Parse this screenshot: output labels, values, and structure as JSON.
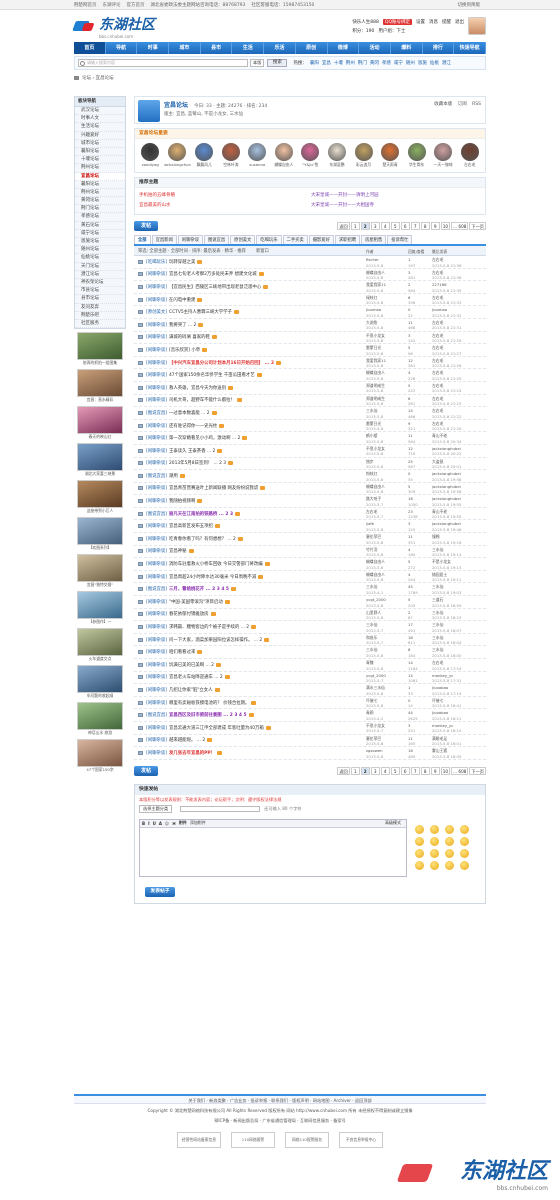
{
  "topbar": {
    "left": [
      "荆楚网首页",
      "东湖评论",
      "官方首页",
      "湖北省委政法委主题网站咨询电话：88768793",
      "社区客服电话：15987453150"
    ],
    "right": "切换到简版"
  },
  "header": {
    "logo": "东湖社区",
    "logo_sub": "bbs.cnhubei.com",
    "user": "快乐人生888",
    "msg": "QQ账号绑定",
    "links": [
      "设置",
      "消息",
      "提醒",
      "退出"
    ],
    "score": "积分：190",
    "group": "用户组：下士"
  },
  "nav": [
    "首页",
    "导航",
    "时事",
    "城市",
    "县市",
    "生活",
    "乐活",
    "原创",
    "微博",
    "活动",
    "爆料",
    "排行",
    "快速导航"
  ],
  "search": {
    "placeholder": "请输入搜索内容",
    "scope": "本版",
    "button": "搜索",
    "hot_label": "热搜：",
    "hot": [
      "襄阳",
      "宜昌",
      "十堰",
      "荆州",
      "荆门",
      "黄冈",
      "孝感",
      "咸宁",
      "随州",
      "恩施",
      "仙桃",
      "潜江"
    ]
  },
  "breadcrumb": "论坛 › 宜昌论坛",
  "forum": {
    "title": "宜昌论坛",
    "today": "今日: 33",
    "topics": "主题: 24276",
    "rank": "排名: 234",
    "moderators": "版主: 宜昌, 蓝莓山, 不是小龙女, 三水仙",
    "actions": [
      "收藏本版",
      "订阅",
      "RSS"
    ]
  },
  "stars": {
    "title": "宜昌论坛星姿",
    "items": [
      "zoodiyag",
      "jackxiongchun",
      "飘飘风儿",
      "空林叶涛",
      "susanna",
      "蝴蝶自由人",
      "\"Y&Ju\"鱼",
      "东湖夏鹏",
      "彩云追月",
      "楚天雨青",
      "华生骨灰",
      "一天一咖啡",
      "左右毛"
    ]
  },
  "recommend": {
    "title": "推荐主题",
    "items": [
      {
        "text": "手机拍的五峰骨骼",
        "style": "a"
      },
      {
        "text": "大宋皇城——开封——清明上河园",
        "style": "b"
      },
      {
        "text": "宜昌最美的山水",
        "style": "a"
      },
      {
        "text": "大宋皇城——开封——大相国寺",
        "style": "b"
      }
    ]
  },
  "pager": {
    "post_button": "发帖",
    "pages": [
      "返回",
      "1",
      "2",
      "3",
      "4",
      "5",
      "6",
      "7",
      "8",
      "9",
      "10",
      "... 608",
      "下一页"
    ],
    "current": "2"
  },
  "tabs": [
    "全部",
    "宜昌新闻",
    "闲聊杂谈",
    "图说宜昌",
    "原创美文",
    "吃喝玩乐",
    "二手买卖",
    "摄影爱好",
    "求职招聘",
    "房屋租售",
    "投诉帮忙"
  ],
  "listhdr": {
    "filter": "筛选: 全部主题 · 全部时间 · 排序: 最后发表 · 精华 · 推荐",
    "new_window": "新窗口",
    "author": "作者",
    "replies": "回复/查看",
    "last": "最后发表"
  },
  "threads": [
    {
      "tag": "[吃喝玩乐]",
      "title": "玩转穿越之美",
      "author": "fischer",
      "date": "2013-5-8",
      "n": "1",
      "v": "197",
      "last": "左右毛",
      "ldate": "2013-5-8 21:36"
    },
    {
      "tag": "[闲聊杂谈]",
      "title": "宜昌七旬老人考察2万多处民未弃 想建文化城",
      "author": "蝴蝶自由人",
      "date": "2013-5-8",
      "n": "3",
      "v": "281",
      "last": "左右毛",
      "ldate": "2013-5-8 21:36"
    },
    {
      "tag": "[闲聊杂谈]",
      "title": "【宜昌民生】西陵区三峡地带出现老鼠泛滥中心",
      "author": "我爱我家11",
      "date": "2013-5-8",
      "n": "2",
      "v": "564",
      "last": "227166",
      "ldate": "2013-5-8 21:35"
    },
    {
      "tag": "[闲聊杂谈]",
      "title": "在闪电中重建",
      "author": "绿枝红",
      "date": "2013-5-8",
      "n": "6",
      "v": "356",
      "last": "左右毛",
      "ldate": "2013-5-8 21:33"
    },
    {
      "tag": "[原创美文]",
      "title": "CCTV5主持人曹霖三峡大学学子",
      "author": "jiuomao",
      "date": "2013-5-8",
      "n": "0",
      "v": "22",
      "last": "jiuomao",
      "ldate": "2013-5-8 21:32"
    },
    {
      "tag": "[闲聊杂谈]",
      "title": "我要哭了 ... 2",
      "author": "大湖鱼",
      "date": "2013-5-8",
      "n": "11",
      "v": "468",
      "last": "左右毛",
      "ldate": "2013-5-8 21:31"
    },
    {
      "tag": "[闲聊杂谈]",
      "title": "满城的碎屑 喜家的鞋",
      "author": "不思小龙女",
      "date": "2013-5-8",
      "n": "3",
      "v": "142",
      "last": "左右毛",
      "ldate": "2013-5-8 21:29"
    },
    {
      "tag": "[闲聊杂谈]",
      "title": "[音乐欣赏] 小草",
      "author": "雷蒙日光",
      "date": "2013-5-8",
      "n": "5",
      "v": "96",
      "last": "左右毛",
      "ldate": "2013-5-8 21:27"
    },
    {
      "tag": "[闲聊杂谈]",
      "title": "【中兴汽车宜昌分公司计划本月16日开始召回】 ... 2",
      "author": "我爱我家11",
      "date": "2013-5-8",
      "n": "12",
      "v": "381",
      "last": "左右毛",
      "ldate": "2013-5-8 21:26",
      "style": "red"
    },
    {
      "tag": "[闲聊杂谈]",
      "title": "47个国家150余名华侨学生 千亩瓜田看才艺",
      "author": "蝴蝶自由人",
      "date": "2013-5-8",
      "n": "4",
      "v": "226",
      "last": "左右毛",
      "ldate": "2013-5-8 21:25"
    },
    {
      "tag": "[闲聊杂谈]",
      "title": "救人英雄，宜昌今天为你送别",
      "author": "郑道明咸生",
      "date": "2013-5-8",
      "n": "5",
      "v": "243",
      "last": "左右毛",
      "ldate": "2013-5-8 21:24"
    },
    {
      "tag": "[闲聊杂谈]",
      "title": "司机大哥，超野车不能什么都拉！",
      "author": "郑道明咸生",
      "date": "2013-5-8",
      "n": "6",
      "v": "261",
      "last": "左右毛",
      "ldate": "2013-5-8 21:23"
    },
    {
      "tag": "[图说宜昌]",
      "title": "一过意本数喜能 ... 2",
      "author": "三水仙",
      "date": "2013-5-8",
      "n": "14",
      "v": "466",
      "last": "左右毛",
      "ldate": "2013-5-8 21:22"
    },
    {
      "tag": "[闲聊杂谈]",
      "title": "还有谁记得你——史光柱",
      "author": "雷蒙日光",
      "date": "2013-5-8",
      "n": "9",
      "v": "321",
      "last": "左右毛",
      "ldate": "2013-5-8 21:20"
    },
    {
      "tag": "[闲聊杂谈]",
      "title": "第一次穿婚看见小小鸡，激动啊 ... 2",
      "author": "鹤小楼",
      "date": "2013-5-8",
      "n": "11",
      "v": "564",
      "last": "青山不老",
      "ldate": "2013-5-8 20:34"
    },
    {
      "tag": "[闲聊杂谈]",
      "title": "王泰读久 王泰茶香 ... 2",
      "author": "不思小龙女",
      "date": "2013-5-8",
      "n": "12",
      "v": "719",
      "last": "jackxionghubei",
      "ldate": "2013-5-8 20:22"
    },
    {
      "tag": "[闲聊杂谈]",
      "title": "2013年5月8日签到！ ... 2 3",
      "author": "独步",
      "date": "2013-5-8",
      "n": "25",
      "v": "587",
      "last": "大盗鼠",
      "ldate": "2013-5-8 20:01"
    },
    {
      "tag": "[图说宜昌]",
      "title": "潮用",
      "author": "钩枝红",
      "date": "2013-5-8",
      "n": "0",
      "v": "35",
      "last": "jackxionghubei",
      "ldate": "2013-5-8 19:58"
    },
    {
      "tag": "[闲聊杂谈]",
      "title": "宜昌青苗营赛送叶上新闻联播 网友纷纷说我谎",
      "author": "蝴蝶自由人",
      "date": "2013-5-8",
      "n": "5",
      "v": "309",
      "last": "jackxionghubei",
      "ldate": "2013-5-8 19:58"
    },
    {
      "tag": "[闲聊杂谈]",
      "title": "我随拍视频啊",
      "author": "路大哈子",
      "date": "2013-5-7",
      "n": "16",
      "v": "1050",
      "last": "jackxionghubei",
      "ldate": "2013-5-8 19:55"
    },
    {
      "tag": "[图说宜昌]",
      "title": "丽凡天在江南拍的铁路桥 ... 2 3",
      "author": "左右毛",
      "date": "2013-5-7",
      "n": "23",
      "v": "1238",
      "last": "青山不老",
      "ldate": "2013-5-8 19:55",
      "style": "purple"
    },
    {
      "tag": "[闲聊杂谈]",
      "title": "宜昌高新区发布五项招",
      "author": "jiafe",
      "date": "2013-5-8",
      "n": "3",
      "v": "125",
      "last": "jackxionghubei",
      "ldate": "2013-5-8 19:46"
    },
    {
      "tag": "[闲聊杂谈]",
      "title": "吃青春你看了吗？有何想想？ ... 2",
      "author": "塞伦菲巴",
      "date": "2013-5-8",
      "n": "11",
      "v": "351",
      "last": "馒棉",
      "ldate": "2013-5-8 19:16"
    },
    {
      "tag": "[闲聊杂谈]",
      "title": "宜昌神秘",
      "author": "竹竹羽",
      "date": "2013-5-8",
      "n": "4",
      "v": "180",
      "last": "三水仙",
      "ldate": "2013-5-8 19:14"
    },
    {
      "tag": "[闲聊杂谈]",
      "title": "消防车驻着救火小桥车回收 今日交警部门将改编",
      "author": "蝴蝶自由人",
      "date": "2013-5-8",
      "n": "5",
      "v": "272",
      "last": "不是小龙女",
      "ldate": "2013-5-8 19:13"
    },
    {
      "tag": "[闲聊杂谈]",
      "title": "宜昌周超24小时降水达30毫米 今日周晚不减",
      "author": "蝴蝶自由人",
      "date": "2013-5-8",
      "n": "4",
      "v": "244",
      "last": "随园居士",
      "ldate": "2013-5-8 19:11"
    },
    {
      "tag": "[图说宜昌]",
      "title": "三月，看桃桃花开 ... 2 3 4 5",
      "author": "三水仙",
      "date": "2013-4-1",
      "n": "45",
      "v": "1789",
      "last": "三水仙",
      "ldate": "2013-5-8 19:03",
      "style": "purple"
    },
    {
      "tag": "[闲聊杂谈]",
      "title": "\"中国·美国零滚沟\"项目启动",
      "author": "ycgt_2000",
      "date": "2013-5-8",
      "n": "5",
      "v": "205",
      "last": "三道石",
      "ldate": "2013-5-8 18:59"
    },
    {
      "tag": "[闲聊杂谈]",
      "title": "春花依郁付锦雅放房",
      "author": "山里野人",
      "date": "2013-5-8",
      "n": "2",
      "v": "87",
      "last": "三水仙",
      "ldate": "2013-5-8 18:23"
    },
    {
      "tag": "[闲聊杂谈]",
      "title": "求韩篇、糖物客边的个被子是手续的 ... 2",
      "author": "三水仙",
      "date": "2013-5-7",
      "n": "17",
      "v": "491",
      "last": "三水仙",
      "ldate": "2013-5-8 18:07"
    },
    {
      "tag": "[闲聊杂谈]",
      "title": "问一下大家，酒菜加果园阳位该怎样操作。 ... 2",
      "author": "和爸乐",
      "date": "2013-5-7",
      "n": "18",
      "v": "611",
      "last": "三水仙",
      "ldate": "2013-5-8 18:04"
    },
    {
      "tag": "[闲聊杂谈]",
      "title": "咱们看看过来",
      "author": "三水仙",
      "date": "2013-5-8",
      "n": "6",
      "v": "184",
      "last": "三水仙",
      "ldate": "2013-5-8 18:00"
    },
    {
      "tag": "[闲聊杂谈]",
      "title": "饥满已美的已美啊 ... 2",
      "author": "青魏",
      "date": "2013-5-8",
      "n": "14",
      "v": "1164",
      "last": "左右毛",
      "ldate": "2013-5-8 17:54"
    },
    {
      "tag": "[闲聊杂谈]",
      "title": "宜昌老火车站降迎通车 ... 2",
      "author": "ycgt_2000",
      "date": "2013-5-7",
      "n": "14",
      "v": "1081",
      "last": "monkey_yc",
      "ldate": "2013-5-8 17:31"
    },
    {
      "tag": "[闲聊杂谈]",
      "title": "几招让你家\"脏\"立女人",
      "author": "满水三水仙",
      "date": "2013-5-8",
      "n": "1",
      "v": "33",
      "last": "jiuoobao",
      "ldate": "2013-5-8 17:19"
    },
    {
      "tag": "[闲聊杂谈]",
      "title": "哪里有卖磁板铁摸电池的？ 价钱合拉期。",
      "author": "吓摧七",
      "date": "2013-5-8",
      "n": "0",
      "v": "14",
      "last": "吓摧七",
      "ldate": "2013-5-8 16:41"
    },
    {
      "tag": "[图说宜昌]",
      "title": "宜昌西区及旧市俯前往景图 ... 2 3 4 5",
      "author": "青鸥",
      "date": "2013-4-2",
      "n": "44",
      "v": "2625",
      "last": "jiuoobao",
      "ldate": "2013-5-8 16:21",
      "style": "purple"
    },
    {
      "tag": "[闲聊杂谈]",
      "title": "宜昌云通大道三江申全部建成 年客吐量为40万箱",
      "author": "不思小龙女",
      "date": "2013-5-7",
      "n": "3",
      "v": "251",
      "last": "monkey_yc",
      "ldate": "2013-5-8 16:10"
    },
    {
      "tag": "[闲聊杂谈]",
      "title": "越来越能呢。 ... 2",
      "author": "塞伦菲巴",
      "date": "2013-5-8",
      "n": "11",
      "v": "165",
      "last": "满眼毛足",
      "ldate": "2013-5-8 16:01"
    },
    {
      "tag": "[闲聊杂谈]",
      "title": "发几张去年宜昌的PP！",
      "author": "zgzowen",
      "date": "2013-5-8",
      "n": "16",
      "v": "489",
      "last": "雾山王狐",
      "ldate": "2013-5-8 16:05",
      "style": "red"
    }
  ],
  "sidebar": {
    "title": "板块导航",
    "groups": [
      "武汉论坛",
      "时事人文",
      "生活论坛",
      "兴趣爱好",
      "城市论坛"
    ],
    "cities": [
      "襄阳论坛",
      "十堰论坛",
      "荆州论坛",
      "宜昌论坛",
      "襄阳论坛",
      "荆州论坛",
      "黄冈论坛",
      "荆门论坛",
      "孝感论坛",
      "黄石论坛",
      "咸宁论坛",
      "恩施论坛",
      "随州论坛",
      "仙桃论坛",
      "天门论坛",
      "潜江论坛",
      "神农架论坛",
      "市县论坛"
    ],
    "groups2": [
      "县市论坛",
      "友问友奔",
      "荆楚乐吧",
      "社区服务"
    ],
    "photos": [
      "依再的抓拍一组图集",
      "宜昌：直水精彩",
      "春天的映山红",
      "湖北大家喜三峡景",
      "这座带到小巨人",
      "【欢图系列】",
      "宜昌\"独特交督\"",
      "【参图作】一",
      "火车道度交点",
      "车问题的收起顺",
      "神话山水 旅游",
      "47个国家150余"
    ]
  },
  "quick": {
    "title": "快速发帖",
    "note": "本版积分等以发表规则：不能发表内容；论坛帮手；文明：遵守版权法律法规",
    "select": "选择主题分类",
    "hint": "还可输入 80 个字符",
    "toolbar": [
      "B",
      "I",
      "U",
      "A",
      "☺",
      "⌘",
      "附件",
      "添加附件"
    ],
    "advanced": "高级模式",
    "submit": "发表帖子"
  },
  "footer": {
    "links": "关于我们 · 新浪类聚 · 广告业务 · 投诉举报 · 联系我们 · 版权声明 · 网站地图 · Archiver · 返回顶部",
    "copyright": "Copyright © 湖北荆楚网络科技有限公司 All Rights Reserved 版权所有 网站 http://www.cnhubei.com 所有 未经授权不得复制或建立镜像",
    "license": "鄂ICP备 · 新闻出版总局 · 广东省通信管理局 · 互联网信息服务 · 备案号",
    "logos": [
      "经营性网站备案信息",
      "110网络报警",
      "网络110报警服务",
      "不良信息举报中心"
    ]
  },
  "watermark": {
    "text": "东湖社区",
    "url": "bbs.cnhubei.com"
  }
}
